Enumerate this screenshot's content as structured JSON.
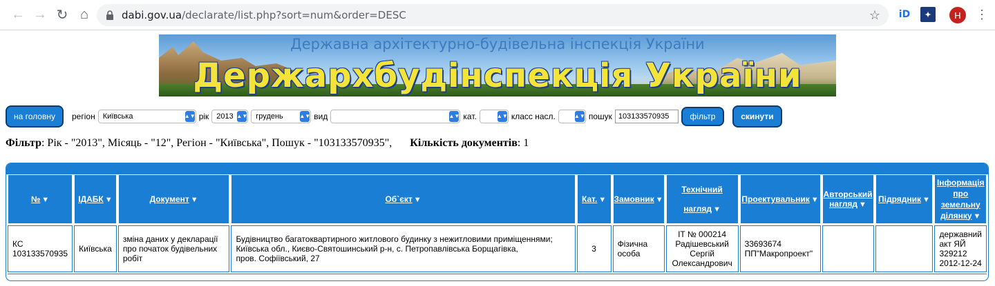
{
  "browser": {
    "url_host": "dabi.gov.ua",
    "url_path": "/declarate/list.php?sort=num&order=DESC",
    "ext_id": "iD",
    "avatar_letter": "H"
  },
  "banner": {
    "subtitle": "Державна архітектурно-будівельна інспекція України",
    "title": "Держархбудінспекція України"
  },
  "filters": {
    "home_label": "на головну",
    "region_label": "регіон",
    "region_value": "Київська",
    "year_label": "рік",
    "year_value": "2013",
    "month_value": "грудень",
    "kind_label": "вид",
    "kind_value": "",
    "category_label": "кат.",
    "category_value": "",
    "class_label": "класс насл.",
    "class_value": "",
    "search_label": "пошук",
    "search_value": "103133570935",
    "filter_label": "фільтр",
    "reset_label": "скинути"
  },
  "summary": {
    "filter_bold": "Фільтр",
    "filter_text": ": Рік - \"2013\", Місяць - \"12\", Регіон - \"Київська\", Пошук - \"103133570935\",",
    "count_bold": "Кількість документів",
    "count_text": ": 1"
  },
  "table": {
    "headers": {
      "num": "№",
      "idabk": "ІДАБК",
      "document": "Документ",
      "object": "Об`єкт",
      "cat": "Кат.",
      "customer": "Замовник",
      "tech1": "Технічний",
      "tech2": "нагляд",
      "designer": "Проектувальник",
      "author1": "Авторський",
      "author2": "нагляд",
      "contractor": "Підрядник",
      "land1": "Інформація",
      "land2": "про",
      "land3": "земельну",
      "land4": "ділянку"
    },
    "row": {
      "num1": "КС",
      "num2": "103133570935",
      "idabk": "Київська",
      "doc1": "зміна даних у декларації",
      "doc2": "про початок будівельних",
      "doc3": "робіт",
      "obj1": "Будівництво багатоквартирного житлового будинку з нежитловими приміщеннями;",
      "obj2": "Київська обл., Києво-Святошинський р-н, с. Петропавлівська Борщагівка,",
      "obj3": "пров. Софіївський, 27",
      "cat": "3",
      "cust1": "Фізична",
      "cust2": "особа",
      "tech1": "IT № 000214",
      "tech2": "Радішевський",
      "tech3": "Сергій",
      "tech4": "Олександрович",
      "des1": "33693674",
      "des2": "ПП\"Макропроект\"",
      "author": "",
      "contractor": "",
      "land1": "державний",
      "land2": "акт ЯЙ",
      "land3": "329212",
      "land4": "2012-12-24"
    }
  }
}
